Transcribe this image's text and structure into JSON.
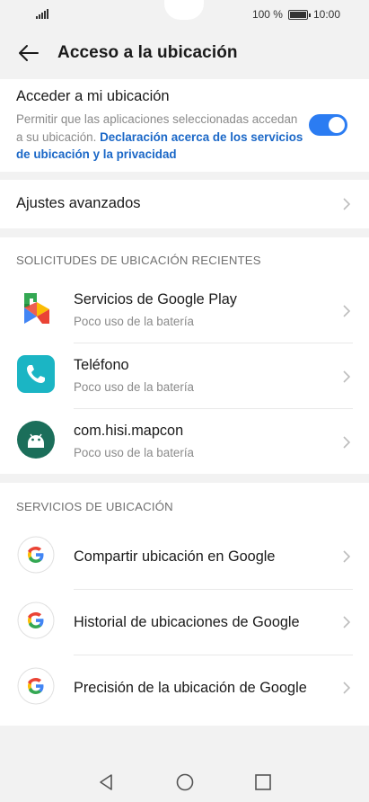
{
  "status_bar": {
    "battery_text": "100 %",
    "time": "10:00"
  },
  "header": {
    "title": "Acceso a la ubicación"
  },
  "access": {
    "title": "Acceder a mi ubicación",
    "description": "Permitir que las aplicaciones seleccionadas accedan a su ubicación.",
    "link": "Declaración acerca de los servicios de ubicación y la privacidad",
    "toggle_on": true
  },
  "advanced": {
    "label": "Ajustes avanzados"
  },
  "recent": {
    "header": "SOLICITUDES DE UBICACIÓN RECIENTES",
    "items": [
      {
        "title": "Servicios de Google Play",
        "subtitle": "Poco uso de la batería",
        "icon": "google-play-services-icon"
      },
      {
        "title": "Teléfono",
        "subtitle": "Poco uso de la batería",
        "icon": "phone-icon"
      },
      {
        "title": "com.hisi.mapcon",
        "subtitle": "Poco uso de la batería",
        "icon": "android-icon"
      }
    ]
  },
  "services": {
    "header": "SERVICIOS DE UBICACIÓN",
    "items": [
      {
        "title": "Compartir ubicación en Google",
        "icon": "google-icon"
      },
      {
        "title": "Historial de ubicaciones de Google",
        "icon": "google-icon"
      },
      {
        "title": "Precisión de la ubicación de Google",
        "icon": "google-icon"
      }
    ]
  },
  "colors": {
    "accent": "#2b7cf2",
    "link": "#1a67c7",
    "phone_icon_bg": "#1bb5c4",
    "android_icon_bg": "#1b6e5a"
  }
}
